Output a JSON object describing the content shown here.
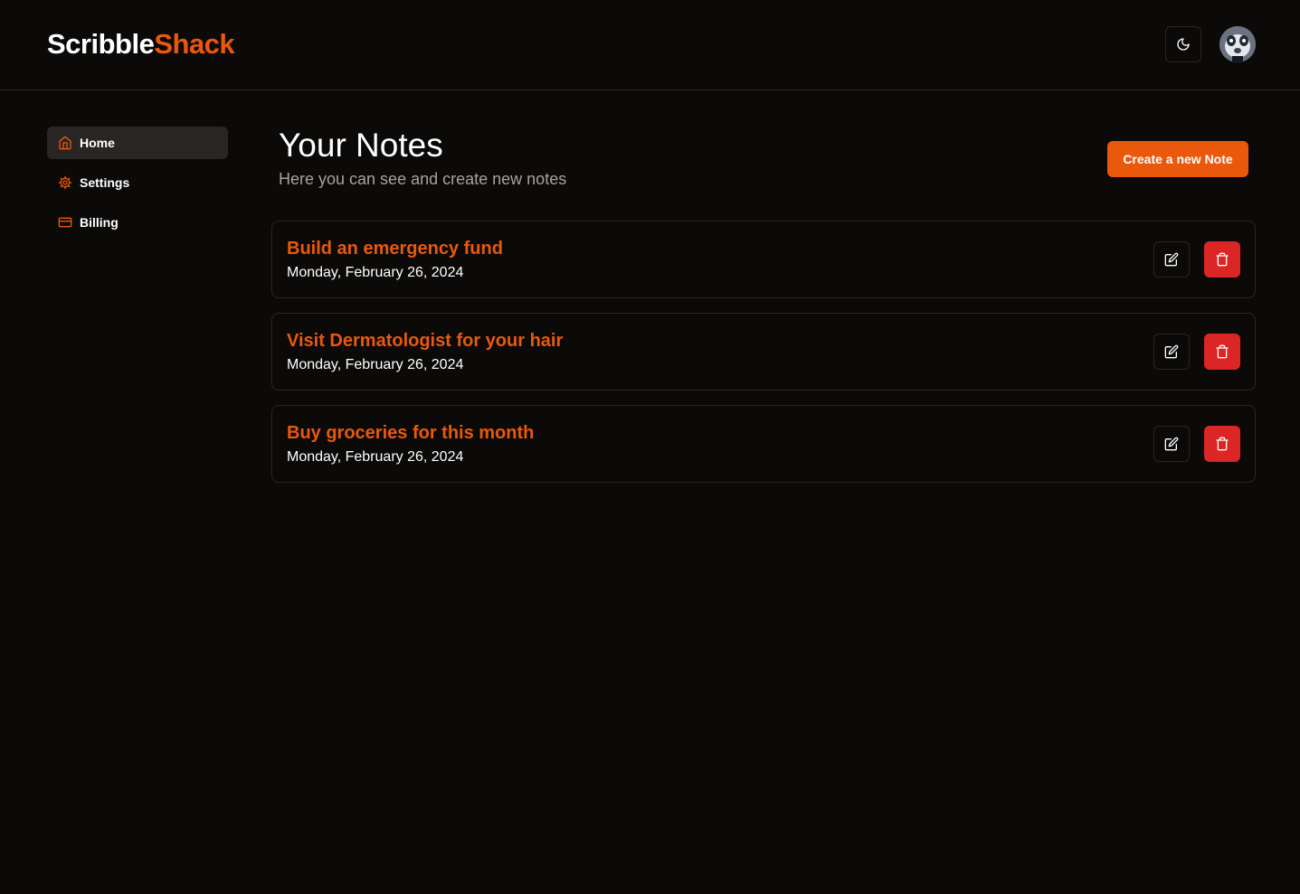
{
  "header": {
    "logo_part1": "Scribble",
    "logo_part2": "Shack",
    "theme_icon": "moon-icon",
    "avatar": "user-avatar"
  },
  "sidebar": {
    "items": [
      {
        "label": "Home",
        "icon": "home-icon",
        "active": true
      },
      {
        "label": "Settings",
        "icon": "gear-icon",
        "active": false
      },
      {
        "label": "Billing",
        "icon": "credit-card-icon",
        "active": false
      }
    ]
  },
  "main": {
    "title": "Your Notes",
    "subtitle": "Here you can see and create new notes",
    "create_label": "Create a new Note"
  },
  "notes": [
    {
      "title": "Build an emergency fund",
      "date": "Monday, February 26, 2024"
    },
    {
      "title": "Visit Dermatologist for your hair",
      "date": "Monday, February 26, 2024"
    },
    {
      "title": "Buy groceries for this month",
      "date": "Monday, February 26, 2024"
    }
  ],
  "colors": {
    "accent": "#ea580c",
    "danger": "#dc2626",
    "background": "#0b0a09",
    "border": "#292524",
    "muted_text": "#a8a29e"
  }
}
